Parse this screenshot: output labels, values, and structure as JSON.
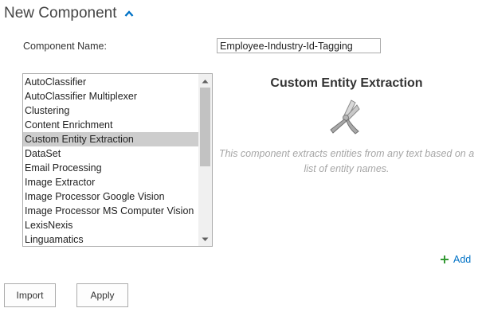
{
  "header": {
    "title": "New Component",
    "chevron_icon": "chevron-up-icon",
    "accent_color": "#0072c6"
  },
  "form": {
    "name_label": "Component Name:",
    "name_value": "Employee-Industry-Id-Tagging"
  },
  "component_list": {
    "items": [
      "AutoClassifier",
      "AutoClassifier Multiplexer",
      "Clustering",
      "Content Enrichment",
      "Custom Entity Extraction",
      "DataSet",
      "Email Processing",
      "Image Extractor",
      "Image Processor Google Vision",
      "Image Processor MS Computer Vision",
      "LexisNexis",
      "Linguamatics"
    ],
    "selected": "Custom Entity Extraction"
  },
  "detail": {
    "title": "Custom Entity Extraction",
    "icon": "extraction-pliers-icon",
    "description": "This component extracts entities from any text based on a list of entity names."
  },
  "actions": {
    "add_label": "Add",
    "add_icon": "plus-icon",
    "import_label": "Import",
    "apply_label": "Apply"
  }
}
